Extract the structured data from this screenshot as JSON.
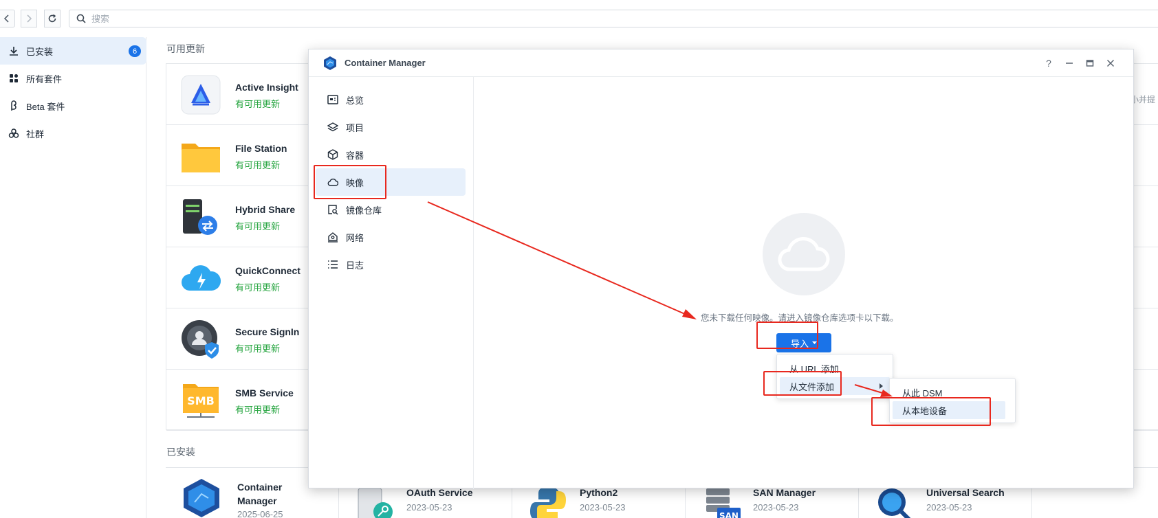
{
  "toolbar": {
    "search_placeholder": "搜索"
  },
  "sidebar": {
    "items": [
      {
        "label": "已安装",
        "badge": "6",
        "icon": "download-icon"
      },
      {
        "label": "所有套件",
        "icon": "grid-icon"
      },
      {
        "label": "Beta 套件",
        "icon": "beta-icon"
      },
      {
        "label": "社群",
        "icon": "community-icon"
      }
    ]
  },
  "main": {
    "updates_title": "可用更新",
    "installed_title": "已安装",
    "updates": [
      {
        "name": "Active Insight",
        "status": "有可用更新",
        "icon": "active-insight-icon"
      },
      {
        "name": "File Station",
        "status": "有可用更新",
        "icon": "folder-icon"
      },
      {
        "name": "Hybrid Share",
        "status": "有可用更新",
        "icon": "hybrid-share-icon"
      },
      {
        "name": "QuickConnect",
        "status": "有可用更新",
        "icon": "quickconnect-icon"
      },
      {
        "name": "Secure SignIn",
        "status": "有可用更新",
        "icon": "secure-signin-icon"
      },
      {
        "name": "SMB Service",
        "status": "有可用更新",
        "icon": "smb-icon"
      }
    ],
    "right_edge_text": "小并提",
    "installed": [
      {
        "name": "Container Manager",
        "date": "2025-06-25",
        "icon": "container-manager-icon"
      },
      {
        "name": "OAuth Service",
        "date": "2023-05-23",
        "icon": "oauth-icon"
      },
      {
        "name": "Python2",
        "date": "2023-05-23",
        "icon": "python-icon"
      },
      {
        "name": "SAN Manager",
        "date": "2023-05-23",
        "icon": "san-icon"
      },
      {
        "name": "Universal Search",
        "date": "2023-05-23",
        "icon": "universal-search-icon"
      }
    ]
  },
  "modal": {
    "title": "Container Manager",
    "help": "?",
    "nav": [
      {
        "label": "总览",
        "icon": "overview-icon"
      },
      {
        "label": "项目",
        "icon": "layers-icon"
      },
      {
        "label": "容器",
        "icon": "cube-icon"
      },
      {
        "label": "映像",
        "icon": "cloud-icon"
      },
      {
        "label": "镜像仓库",
        "icon": "registry-icon"
      },
      {
        "label": "网络",
        "icon": "network-icon"
      },
      {
        "label": "日志",
        "icon": "list-icon"
      }
    ],
    "empty_message": "您未下载任何映像。请进入镜像仓库选项卡以下载。",
    "import_label": "导入",
    "import_menu": [
      "从 URL 添加",
      "从文件添加"
    ],
    "file_submenu": [
      "从此 DSM",
      "从本地设备"
    ]
  },
  "colors": {
    "accent": "#1a73e8",
    "update_green": "#22a33c",
    "annotation_red": "#e8281e"
  }
}
